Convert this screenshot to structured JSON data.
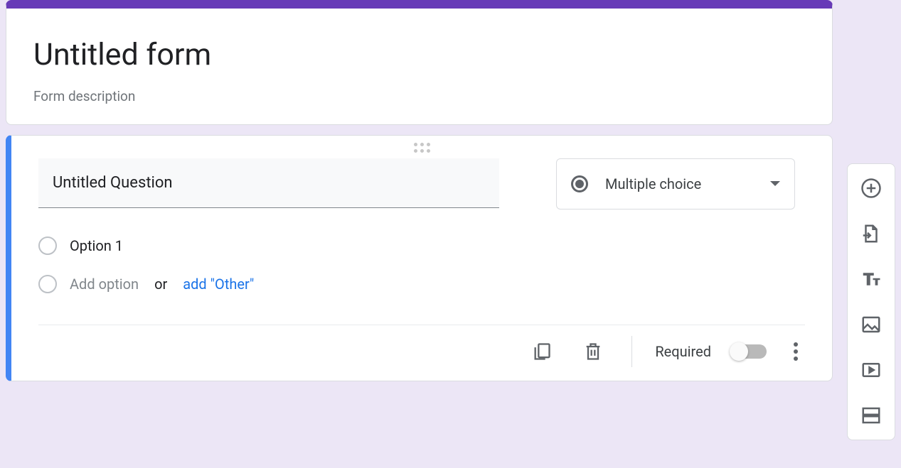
{
  "form_header": {
    "title": "Untitled form",
    "description_placeholder": "Form description"
  },
  "question": {
    "title": "Untitled Question",
    "type_label": "Multiple choice",
    "options": [
      {
        "label": "Option 1"
      }
    ],
    "add_option_text": "Add option",
    "or_text": "or",
    "add_other_text": "add \"Other\""
  },
  "footer": {
    "required_label": "Required",
    "required_value": false
  },
  "toolbar": {
    "items": [
      {
        "name": "add-question",
        "icon": "plus-circle"
      },
      {
        "name": "import-questions",
        "icon": "import-file"
      },
      {
        "name": "add-title",
        "icon": "text-tt"
      },
      {
        "name": "add-image",
        "icon": "image"
      },
      {
        "name": "add-video",
        "icon": "video"
      },
      {
        "name": "add-section",
        "icon": "section"
      }
    ]
  }
}
